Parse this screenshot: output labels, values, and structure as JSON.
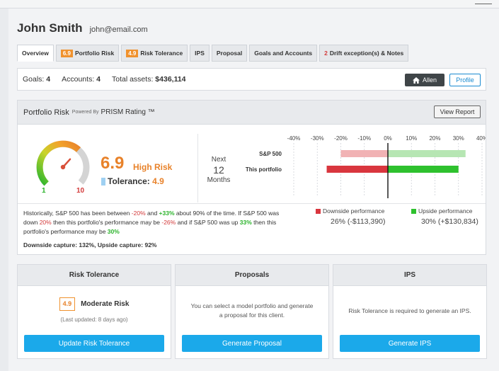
{
  "client": {
    "name": "John Smith",
    "email": "john@email.com"
  },
  "tabs": [
    {
      "label": "Overview"
    },
    {
      "badge": "6.9",
      "label": "Portfolio Risk"
    },
    {
      "badge": "4.9",
      "label": "Risk Tolerance"
    },
    {
      "label": "IPS"
    },
    {
      "label": "Proposal"
    },
    {
      "label": "Goals and Accounts"
    },
    {
      "count": "2",
      "label": "Drift exception(s) & Notes"
    }
  ],
  "summary": {
    "goals_label": "Goals:",
    "goals": "4",
    "accounts_label": "Accounts:",
    "accounts": "4",
    "assets_label": "Total assets:",
    "assets": "$436,114",
    "advisor_button": "Allen",
    "profile_button": "Profile"
  },
  "risk": {
    "title": "Portfolio Risk",
    "powered_by": "Powered By",
    "prism": "PRISM Rating ™",
    "view_report": "View Report",
    "score": "6.9",
    "score_label": "High Risk",
    "tolerance_label": "Tolerance:",
    "tolerance": "4.9",
    "gauge_min": "1",
    "gauge_max": "10",
    "gauge_value": 6.9,
    "next_a": "Next",
    "next_b": "12",
    "next_c": "Months",
    "note": {
      "p1": "Historically, S&P 500 has been between ",
      "v1": "-20%",
      "p2": " and ",
      "v2": "+33%",
      "p3": " about 90% of the time. If S&P 500 was down ",
      "v3": "20%",
      "p4": " then this portfolio's performance may be ",
      "v4": "-26%",
      "p5": " and if S&P 500 was up ",
      "v5": "33%",
      "p6": " then this portfolio's performance may be ",
      "v6": "30%"
    },
    "capture": "Downside capture: 132%, Upside capture: 92%",
    "downside_label": "Downside performance",
    "downside_value": "26% (-$113,390)",
    "upside_label": "Upside performance",
    "upside_value": "30% (+$130,834)",
    "colors": {
      "down": "#d9363e",
      "down_light": "#f1b2b4",
      "up": "#2ec12e",
      "up_light": "#b6e6b3"
    }
  },
  "chart_data": {
    "type": "bar",
    "orientation": "horizontal",
    "categories": [
      "S&P 500",
      "This portfolio"
    ],
    "x_ticks": [
      "-40%",
      "-30%",
      "-20%",
      "-10%",
      "0%",
      "10%",
      "20%",
      "30%",
      "40%"
    ],
    "xlim": [
      -40,
      40
    ],
    "series": [
      {
        "name": "Downside performance",
        "values": [
          -20,
          -26
        ]
      },
      {
        "name": "Upside performance",
        "values": [
          33,
          30
        ]
      }
    ]
  },
  "cards": [
    {
      "title": "Risk Tolerance",
      "badge": "4.9",
      "label": "Moderate Risk",
      "updated": "(Last updated: 8 days ago)",
      "button": "Update Risk Tolerance"
    },
    {
      "title": "Proposals",
      "text": "You can select a model portfolio and generate a proposal for this client.",
      "button": "Generate Proposal"
    },
    {
      "title": "IPS",
      "text": "Risk Tolerance is required to generate an IPS.",
      "button": "Generate IPS"
    }
  ]
}
